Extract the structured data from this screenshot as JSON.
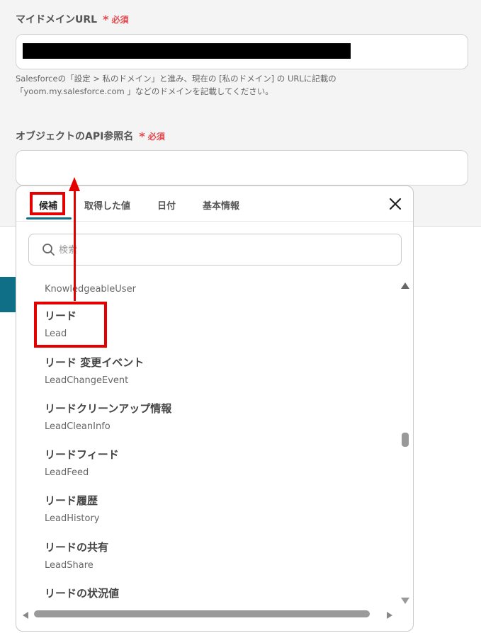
{
  "domain_field": {
    "label": "マイドメインURL",
    "required_star": "*",
    "required_text": "必須",
    "hint_line1": "Salesforceの「設定 > 私のドメイン」と進み、現在の [私のドメイン] の URLに記載の",
    "hint_line2": "「yoom.my.salesforce.com 」などのドメインを記載してください。"
  },
  "object_field": {
    "label": "オブジェクトのAPI参照名",
    "required_star": "*",
    "required_text": "必須",
    "value": ""
  },
  "popup": {
    "tabs": [
      {
        "label": "候補"
      },
      {
        "label": "取得した値"
      },
      {
        "label": "日付"
      },
      {
        "label": "基本情報"
      }
    ],
    "search_placeholder": "検索",
    "partial_top_item": "KnowledgeableUser",
    "items": [
      {
        "jp": "リード",
        "en": "Lead"
      },
      {
        "jp": "リード 変更イベント",
        "en": "LeadChangeEvent"
      },
      {
        "jp": "リードクリーンアップ情報",
        "en": "LeadCleanInfo"
      },
      {
        "jp": "リードフィード",
        "en": "LeadFeed"
      },
      {
        "jp": "リード履歴",
        "en": "LeadHistory"
      },
      {
        "jp": "リードの共有",
        "en": "LeadShare"
      },
      {
        "jp": "リードの状況値",
        "en": ""
      }
    ]
  },
  "colors": {
    "accent": "#0e6f86",
    "required": "#e5484d",
    "annotation": "#e50000"
  },
  "icons": {
    "search": "search-icon",
    "close": "close-icon"
  }
}
